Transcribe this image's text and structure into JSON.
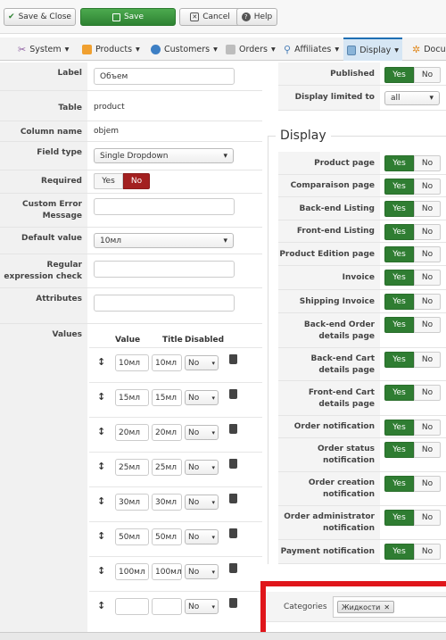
{
  "toolbar": {
    "save_close": "Save & Close",
    "save": "Save",
    "cancel": "Cancel",
    "help": "Help"
  },
  "menu": {
    "system": "System",
    "products": "Products",
    "customers": "Customers",
    "orders": "Orders",
    "affiliates": "Affiliates",
    "display": "Display",
    "docu": "Docu"
  },
  "form": {
    "label": {
      "label": "Label",
      "value": "Объем"
    },
    "table": {
      "label": "Table",
      "value": "product"
    },
    "column_name": {
      "label": "Column name",
      "value": "objem"
    },
    "field_type": {
      "label": "Field type",
      "value": "Single Dropdown"
    },
    "required": {
      "label": "Required",
      "yes": "Yes",
      "no": "No"
    },
    "custom_error": {
      "label": "Custom Error Message",
      "value": ""
    },
    "default_value": {
      "label": "Default value",
      "value": "10мл"
    },
    "regex": {
      "label": "Regular expression check",
      "value": ""
    },
    "attributes": {
      "label": "Attributes",
      "value": ""
    },
    "values": {
      "label": "Values"
    }
  },
  "values_table": {
    "headers": {
      "value": "Value",
      "title": "Title",
      "disabled": "Disabled"
    },
    "rows": [
      {
        "value": "10мл",
        "title": "10мл",
        "disabled": "No"
      },
      {
        "value": "15мл",
        "title": "15мл",
        "disabled": "No"
      },
      {
        "value": "20мл",
        "title": "20мл",
        "disabled": "No"
      },
      {
        "value": "25мл",
        "title": "25мл",
        "disabled": "No"
      },
      {
        "value": "30мл",
        "title": "30мл",
        "disabled": "No"
      },
      {
        "value": "50мл",
        "title": "50мл",
        "disabled": "No"
      },
      {
        "value": "100мл",
        "title": "100мл",
        "disabled": "No"
      },
      {
        "value": "",
        "title": "",
        "disabled": "No"
      }
    ]
  },
  "right_top": {
    "published": {
      "label": "Published",
      "yes": "Yes",
      "no": "No"
    },
    "display_limited": {
      "label": "Display limited to",
      "value": "all"
    }
  },
  "display_section": {
    "title": "Display",
    "yes": "Yes",
    "no": "No",
    "rows": [
      "Product page",
      "Comparaison page",
      "Back-end Listing",
      "Front-end Listing",
      "Product Edition page",
      "Invoice",
      "Shipping Invoice",
      "Back-end Order details page",
      "Back-end Cart details page",
      "Front-end Cart details page",
      "Order notification",
      "Order status notification",
      "Order creation notification",
      "Order administrator notification",
      "Payment notification"
    ]
  },
  "categories": {
    "label": "Categories",
    "tag": "Жидкости"
  },
  "colors": {
    "green": "#2f7d32",
    "red": "#a32020",
    "highlight": "#e0161b",
    "accent": "#1e6fb3"
  }
}
